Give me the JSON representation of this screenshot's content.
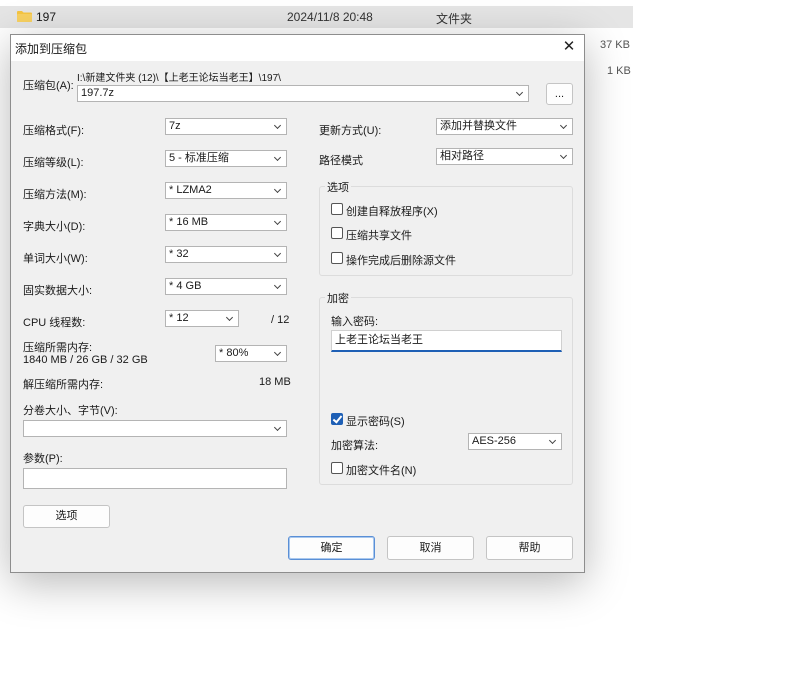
{
  "explorer": {
    "row": {
      "name": "197",
      "date": "2024/11/8 20:48",
      "type": "文件夹"
    },
    "sizes": [
      "37 KB",
      "1 KB"
    ]
  },
  "dialog": {
    "title": "添加到压缩包",
    "archive": {
      "label": "压缩包(A):",
      "path": "I:\\新建文件夹 (12)\\【上老王论坛当老王】\\197\\",
      "filename": "197.7z",
      "browse_label": "..."
    },
    "left": {
      "format": {
        "label": "压缩格式(F):",
        "value": "7z"
      },
      "level": {
        "label": "压缩等级(L):",
        "value": "5 - 标准压缩"
      },
      "method": {
        "label": "压缩方法(M):",
        "value": "*  LZMA2"
      },
      "dict": {
        "label": "字典大小(D):",
        "value": "*  16 MB"
      },
      "word": {
        "label": "单词大小(W):",
        "value": "*  32"
      },
      "solid": {
        "label": "固实数据大小:",
        "value": "*  4 GB"
      },
      "threads": {
        "label": "CPU 线程数:",
        "value": "*  12",
        "max": "/ 12"
      },
      "memory": {
        "label": "压缩所需内存:",
        "detail": "1840 MB / 26 GB / 32 GB",
        "value": "*  80%"
      },
      "decompress": {
        "label": "解压缩所需内存:",
        "value": "18 MB"
      },
      "volume": {
        "label": "分卷大小、字节(V):",
        "value": ""
      },
      "params": {
        "label": "参数(P):",
        "value": ""
      },
      "options_button": "选项"
    },
    "right": {
      "update": {
        "label": "更新方式(U):",
        "value": "添加并替换文件"
      },
      "pathmode": {
        "label": "路径模式",
        "value": "相对路径"
      },
      "options": {
        "title": "选项",
        "sfx": {
          "label": "创建自释放程序(X)",
          "checked": false
        },
        "shared": {
          "label": "压缩共享文件",
          "checked": false
        },
        "delete": {
          "label": "操作完成后删除源文件",
          "checked": false
        }
      },
      "encryption": {
        "title": "加密",
        "password_label": "输入密码:",
        "password_value": "上老王论坛当老王",
        "show_password": {
          "label": "显示密码(S)",
          "checked": true
        },
        "method_label": "加密算法:",
        "method_value": "AES-256",
        "encrypt_names": {
          "label": "加密文件名(N)",
          "checked": false
        }
      }
    },
    "buttons": {
      "ok": "确定",
      "cancel": "取消",
      "help": "帮助"
    }
  }
}
